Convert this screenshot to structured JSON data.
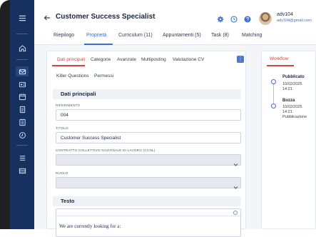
{
  "header": {
    "title": "Customer Success Specialist",
    "user_name": "adv104",
    "user_email": "adv104@gmail.com"
  },
  "tabs": [
    {
      "label": "Riepilogo"
    },
    {
      "label": "Proprietà"
    },
    {
      "label": "Curriculum (11)"
    },
    {
      "label": "Appuntamenti (5)"
    },
    {
      "label": "Task (8)"
    },
    {
      "label": "Matching"
    }
  ],
  "subtabs": [
    {
      "label": "Dati principali"
    },
    {
      "label": "Categorie"
    },
    {
      "label": "Avanzate"
    },
    {
      "label": "Multiposting"
    },
    {
      "label": "Valutazione CV"
    },
    {
      "label": "Killer Questions"
    },
    {
      "label": "Permessi"
    }
  ],
  "form": {
    "section_title": "Dati principali",
    "riferimento_label": "RIFERIMENTO",
    "riferimento_value": "004",
    "titolo_label": "TITOLO",
    "titolo_value": "Customer Success Specialist",
    "ccnl_label": "CONTRATTO COLLETTIVO NAZIONALE DI LAVORO (CCNL)",
    "ccnl_value": "",
    "ruolo_label": "RUOLO",
    "ruolo_value": "",
    "testo_title": "Testo",
    "testo_value": "We are currently looking for a:"
  },
  "workflow": {
    "tab_label": "Workflow",
    "events": [
      {
        "title": "Pubblicato",
        "date": "10/02/2025",
        "time": "14:21"
      },
      {
        "title": "Bozza",
        "date": "10/02/2025",
        "time": "14:21",
        "status": "Pubblicazione"
      }
    ]
  },
  "colors": {
    "sidebar": "#16315f",
    "accent": "#3d6fd0",
    "subtab_accent": "#d6453d"
  }
}
